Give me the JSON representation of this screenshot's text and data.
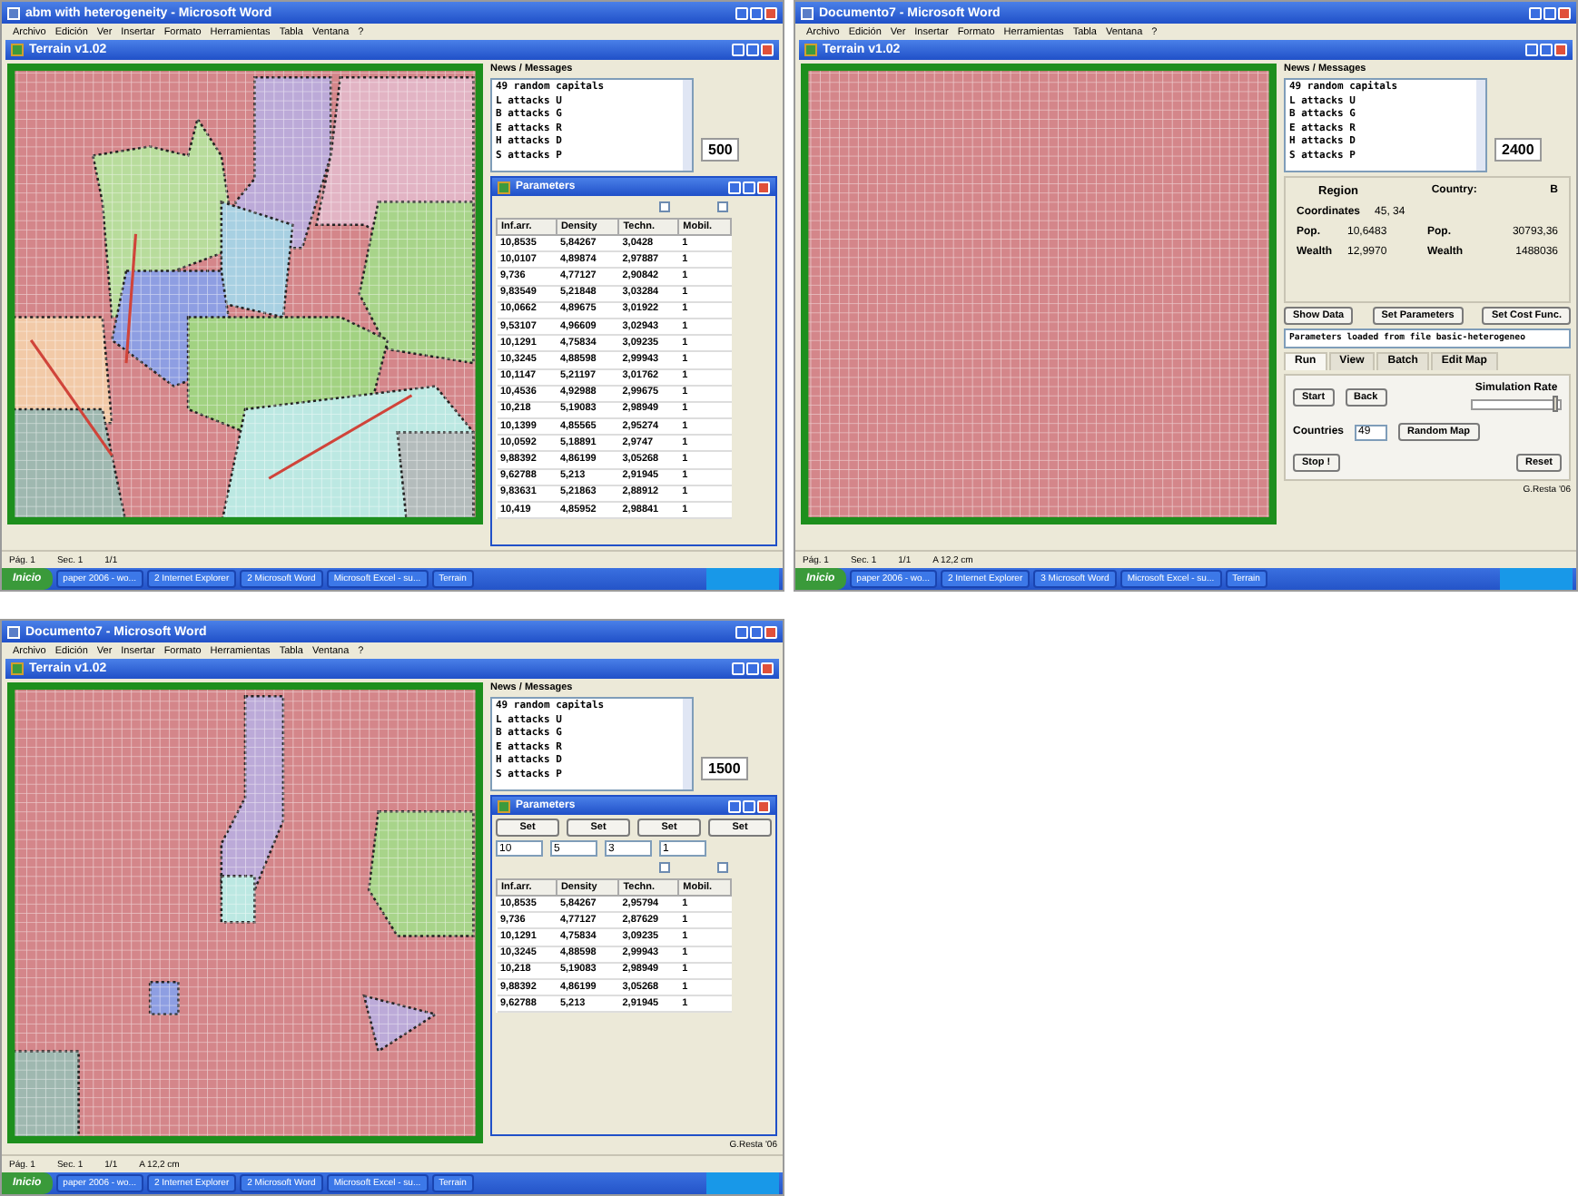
{
  "screenshots": [
    {
      "word_title": "abm with heterogeneity - Microsoft Word",
      "menu": [
        "Archivo",
        "Edición",
        "Ver",
        "Insertar",
        "Formato",
        "Herramientas",
        "Tabla",
        "Ventana",
        "?"
      ],
      "app_title": "Terrain v1.02",
      "news_heading": "News / Messages",
      "news": [
        "49 random capitals",
        "L attacks U",
        "B attacks G",
        "E attacks R",
        "H attacks D",
        "S attacks P"
      ],
      "counter": "500",
      "right_panel": {
        "kind": "parameters",
        "title": "Parameters",
        "checkboxes": [
          {
            "checked": false
          },
          {
            "checked": false
          }
        ],
        "columns": [
          "Inf.arr.",
          "Density",
          "Techn.",
          "Mobil."
        ],
        "rows": [
          [
            "10,8535",
            "5,84267",
            "3,0428",
            "1"
          ],
          [
            "10,0107",
            "4,89874",
            "2,97887",
            "1"
          ],
          [
            "9,736",
            "4,77127",
            "2,90842",
            "1"
          ],
          [
            "9,83549",
            "5,21848",
            "3,03284",
            "1"
          ],
          [
            "10,0662",
            "4,89675",
            "3,01922",
            "1"
          ],
          [
            "9,53107",
            "4,96609",
            "3,02943",
            "1"
          ],
          [
            "10,1291",
            "4,75834",
            "3,09235",
            "1"
          ],
          [
            "10,3245",
            "4,88598",
            "2,99943",
            "1"
          ],
          [
            "10,1147",
            "5,21197",
            "3,01762",
            "1"
          ],
          [
            "10,4536",
            "4,92988",
            "2,99675",
            "1"
          ],
          [
            "10,218",
            "5,19083",
            "2,98949",
            "1"
          ],
          [
            "10,1399",
            "4,85565",
            "2,95274",
            "1"
          ],
          [
            "10,0592",
            "5,18891",
            "2,9747",
            "1"
          ],
          [
            "9,88392",
            "4,86199",
            "3,05268",
            "1"
          ],
          [
            "9,62788",
            "5,213",
            "2,91945",
            "1"
          ],
          [
            "9,83631",
            "5,21863",
            "2,88912",
            "1"
          ],
          [
            "10,419",
            "4,85952",
            "2,98841",
            "1"
          ]
        ]
      },
      "status_bar": [
        "Pág. 1",
        "Sec. 1",
        "1/1"
      ],
      "taskbar": {
        "start": "Inicio",
        "items": [
          "paper 2006 - wo...",
          "2 Internet Explorer",
          "2 Microsoft Word",
          "Microsoft Excel - su...",
          "Terrain"
        ]
      }
    },
    {
      "word_title": "Documento7 - Microsoft Word",
      "menu": [
        "Archivo",
        "Edición",
        "Ver",
        "Insertar",
        "Formato",
        "Herramientas",
        "Tabla",
        "Ventana",
        "?"
      ],
      "app_title": "Terrain v1.02",
      "news_heading": "News / Messages",
      "news": [
        "49 random capitals",
        "L attacks U",
        "B attacks G",
        "E attacks R",
        "H attacks D",
        "S attacks P"
      ],
      "counter": "2400",
      "right_panel": {
        "kind": "controls",
        "region_title": "Region",
        "country_label": "Country:",
        "country": "B",
        "coordinates_label": "Coordinates",
        "coordinates": "45, 34",
        "stats": [
          {
            "label": "Pop.",
            "value": "10,6483",
            "country_label": "Pop.",
            "country_value": "30793,36"
          },
          {
            "label": "Wealth",
            "value": "12,9970",
            "country_label": "Wealth",
            "country_value": "1488036"
          }
        ],
        "buttons": [
          "Show Data",
          "Set Parameters",
          "Set Cost Func."
        ],
        "log": "Parameters loaded from file basic-heterogeneo",
        "tabs": [
          {
            "label": "Run",
            "selected": true
          },
          {
            "label": "View",
            "selected": false
          },
          {
            "label": "Batch",
            "selected": false
          },
          {
            "label": "Edit Map",
            "selected": false
          }
        ],
        "start": "Start",
        "back": "Back",
        "simulation_rate": {
          "label": "Simulation Rate",
          "level": 0.95
        },
        "countries_label": "Countries",
        "countries": "49",
        "random_map": "Random Map",
        "stop": "Stop !",
        "reset": "Reset",
        "credit": "G.Resta '06"
      },
      "status_bar": [
        "Pág. 1",
        "Sec. 1",
        "1/1",
        "A 12,2 cm"
      ],
      "taskbar": {
        "start": "Inicio",
        "items": [
          "paper 2006 - wo...",
          "2 Internet Explorer",
          "3 Microsoft Word",
          "Microsoft Excel - su...",
          "Terrain"
        ]
      }
    },
    {
      "word_title": "Documento7 - Microsoft Word",
      "menu": [
        "Archivo",
        "Edición",
        "Ver",
        "Insertar",
        "Formato",
        "Herramientas",
        "Tabla",
        "Ventana",
        "?"
      ],
      "app_title": "Terrain v1.02",
      "news_heading": "News / Messages",
      "news": [
        "49 random capitals",
        "L attacks U",
        "B attacks G",
        "E attacks R",
        "H attacks D",
        "S attacks P"
      ],
      "counter": "1500",
      "right_panel": {
        "kind": "parameters",
        "title": "Parameters",
        "set_buttons": [
          "Set",
          "Set",
          "Set",
          "Set"
        ],
        "fields": [
          "10",
          "5",
          "3",
          "1"
        ],
        "checkboxes": [
          {
            "checked": false
          },
          {
            "checked": false
          }
        ],
        "columns": [
          "Inf.arr.",
          "Density",
          "Techn.",
          "Mobil."
        ],
        "rows": [
          [
            "10,8535",
            "5,84267",
            "2,95794",
            "1"
          ],
          [
            "9,736",
            "4,77127",
            "2,87629",
            "1"
          ],
          [
            "10,1291",
            "4,75834",
            "3,09235",
            "1"
          ],
          [
            "10,3245",
            "4,88598",
            "2,99943",
            "1"
          ],
          [
            "10,218",
            "5,19083",
            "2,98949",
            "1"
          ],
          [
            "9,88392",
            "4,86199",
            "3,05268",
            "1"
          ],
          [
            "9,62788",
            "5,213",
            "2,91945",
            "1"
          ]
        ],
        "credit": "G.Resta '06"
      },
      "status_bar": [
        "Pág. 1",
        "Sec. 1",
        "1/1",
        "A 12,2 cm"
      ],
      "taskbar": {
        "start": "Inicio",
        "items": [
          "paper 2006 - wo...",
          "2 Internet Explorer",
          "2 Microsoft Word",
          "Microsoft Excel - su...",
          "Terrain"
        ]
      }
    }
  ]
}
